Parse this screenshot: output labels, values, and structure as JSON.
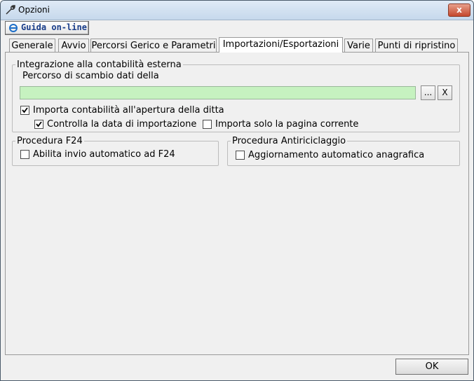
{
  "window": {
    "title": "Opzioni",
    "close_label": "x"
  },
  "toolbar": {
    "help_label": "Guida on-line"
  },
  "tabs": [
    {
      "label": "Generale"
    },
    {
      "label": "Avvio"
    },
    {
      "label": "Percorsi Gerico e Parametri"
    },
    {
      "label": "Importazioni/Esportazioni"
    },
    {
      "label": "Varie"
    },
    {
      "label": "Punti di ripristino"
    }
  ],
  "integration": {
    "legend": "Integrazione alla contabilità esterna",
    "path_label": "Percorso di scambio dati della",
    "path_value": "",
    "browse_label": "...",
    "clear_label": "X",
    "import_on_open": {
      "label": "Importa contabilità all'apertura della ditta",
      "checked": true
    },
    "check_import_date": {
      "label": "Controlla la data di importazione",
      "checked": true
    },
    "import_current_page": {
      "label": "Importa solo la pagina corrente",
      "checked": false
    }
  },
  "f24": {
    "legend": "Procedura F24",
    "auto_send": {
      "label": "Abilita invio automatico ad F24",
      "checked": false
    }
  },
  "antiriciclaggio": {
    "legend": "Procedura Antiriciclaggio",
    "auto_update": {
      "label": "Aggiornamento automatico anagrafica",
      "checked": false
    }
  },
  "footer": {
    "ok_label": "OK"
  },
  "colors": {
    "path_input_bg": "#c6f2c0",
    "title_accent": "#1a3e8a"
  }
}
